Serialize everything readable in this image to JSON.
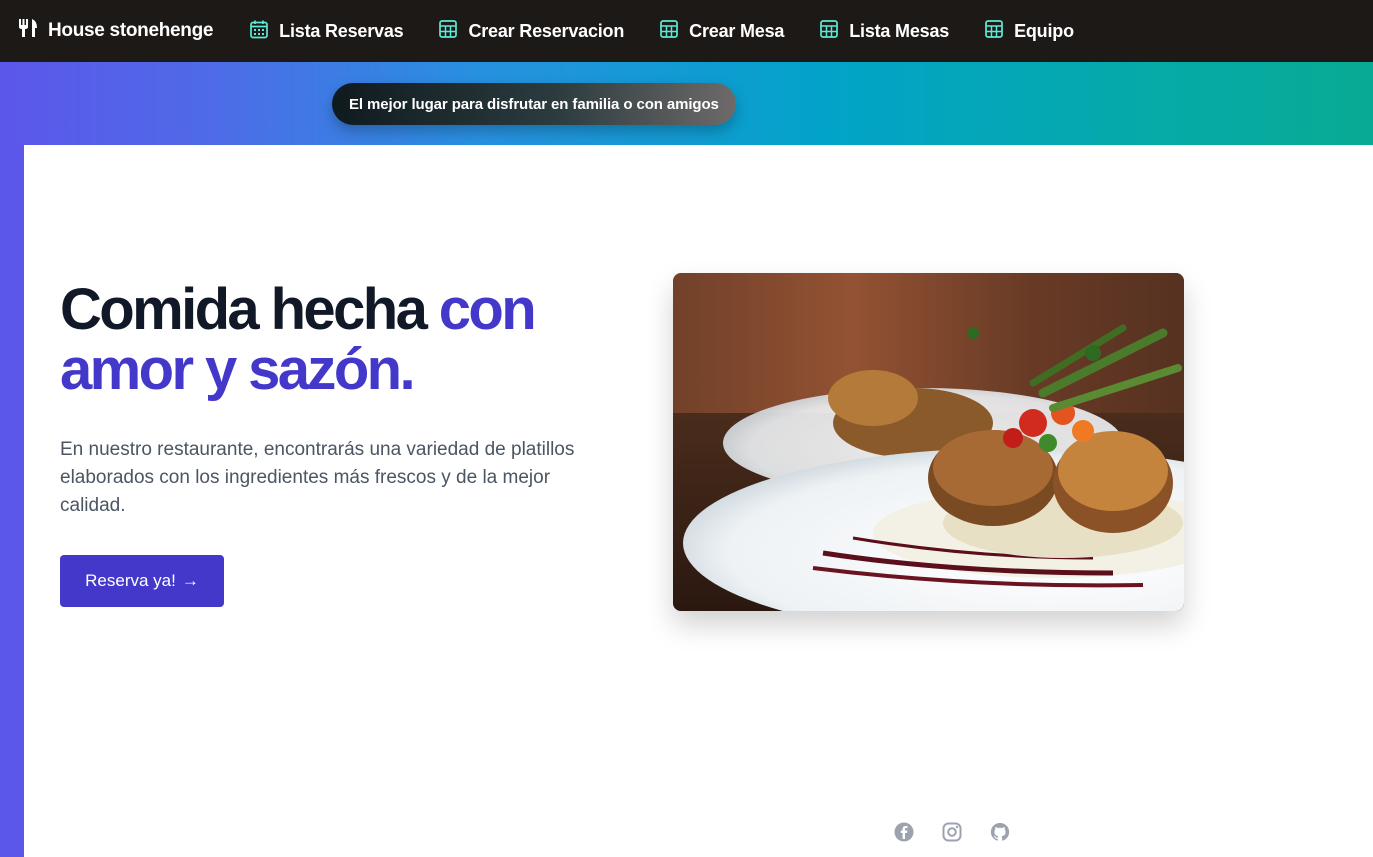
{
  "nav": {
    "brand": "House stonehenge",
    "brand_icon": "utensils-icon",
    "links": [
      {
        "label": "Lista Reservas",
        "icon": "calendar-icon"
      },
      {
        "label": "Crear Reservacion",
        "icon": "table-icon"
      },
      {
        "label": "Crear Mesa",
        "icon": "table-icon"
      },
      {
        "label": "Lista Mesas",
        "icon": "table-icon"
      },
      {
        "label": "Equipo",
        "icon": "table-icon"
      }
    ]
  },
  "banner": {
    "tagline": "El mejor lugar para disfrutar en familia o con amigos"
  },
  "hero": {
    "title_part1": "Comida hecha ",
    "title_part2": "con amor y sazón.",
    "description": "En nuestro restaurante, encontrarás una variedad de platillos elaborados con los ingredientes más frescos y de la mejor calidad.",
    "cta_label": "Reserva ya!",
    "cta_arrow": "→",
    "image_alt": "Plato de comida"
  },
  "footer": {
    "social": [
      "facebook-icon",
      "instagram-icon",
      "github-icon"
    ]
  },
  "colors": {
    "nav_bg": "#1c1917",
    "accent": "#4338ca",
    "icon_teal": "#5eead4",
    "gradient_start": "#5b57ea",
    "gradient_end": "#08aa94"
  }
}
